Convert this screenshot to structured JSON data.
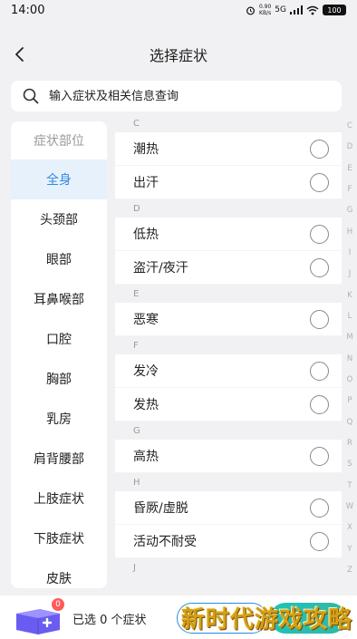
{
  "status_bar": {
    "time": "14:00",
    "speed_value": "0.90",
    "speed_unit": "KB/s",
    "network": "5G",
    "battery": "100"
  },
  "header": {
    "title": "选择症状"
  },
  "search": {
    "placeholder": "输入症状及相关信息查询"
  },
  "sidebar": {
    "header": "症状部位",
    "items": [
      "全身",
      "头颈部",
      "眼部",
      "耳鼻喉部",
      "口腔",
      "胸部",
      "乳房",
      "肩背腰部",
      "上肢症状",
      "下肢症状",
      "皮肤"
    ],
    "active_index": 0
  },
  "symptom_list": [
    {
      "letter": "C",
      "items": [
        "潮热",
        "出汗"
      ]
    },
    {
      "letter": "D",
      "items": [
        "低热",
        "盗汗/夜汗"
      ]
    },
    {
      "letter": "E",
      "items": [
        "恶寒"
      ]
    },
    {
      "letter": "F",
      "items": [
        "发冷",
        "发热"
      ]
    },
    {
      "letter": "G",
      "items": [
        "高热"
      ]
    },
    {
      "letter": "H",
      "items": [
        "昏厥/虚脱",
        "活动不耐受"
      ]
    },
    {
      "letter": "J",
      "items": []
    }
  ],
  "alpha_index": [
    "C",
    "D",
    "E",
    "F",
    "G",
    "H",
    "I",
    "J",
    "K",
    "L",
    "M",
    "N",
    "O",
    "P",
    "Q",
    "R",
    "S",
    "T",
    "W",
    "X",
    "Y",
    "Z"
  ],
  "bottom_bar": {
    "badge_count": "0",
    "selected_text": "已选 0 个症状"
  },
  "watermark": "新时代游戏攻略",
  "colors": {
    "accent": "#2f8ae0",
    "active_bg": "#e7f1fb",
    "confirm_gradient_start": "#1fc3b8",
    "badge": "#ff5a5a"
  }
}
